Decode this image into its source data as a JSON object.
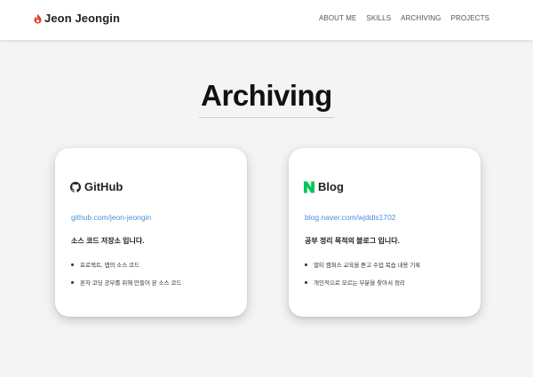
{
  "header": {
    "brand": "Jeon Jeongin",
    "brand_icon": "flame-logo-icon",
    "nav": [
      "ABOUT ME",
      "SKILLS",
      "ARCHIVING",
      "PROJECTS"
    ]
  },
  "section": {
    "title": "Archiving"
  },
  "cards": [
    {
      "icon": "github-icon",
      "title": "GitHub",
      "link": "github.com/jeon-jeongin",
      "desc": "소스 코드 저장소 입니다.",
      "items": [
        "프로젝트, 앱의 소스 코드",
        "혼자 코딩 공부를 위해 만들어 본 소스 코드"
      ]
    },
    {
      "icon": "naver-blog-icon",
      "title": "Blog",
      "link": "blog.naver.com/wjddls1702",
      "desc": "공부 정리 목적의 블로그 입니다.",
      "items": [
        "멀티 캠퍼스 교육을 듣고 수업 복습 내용 기록",
        "개인적으로 모르는 부분을 찾아서 정리"
      ]
    }
  ],
  "colors": {
    "accent_link": "#4a90d9",
    "naver_green": "#03c75a",
    "brand_red": "#e0452b"
  }
}
